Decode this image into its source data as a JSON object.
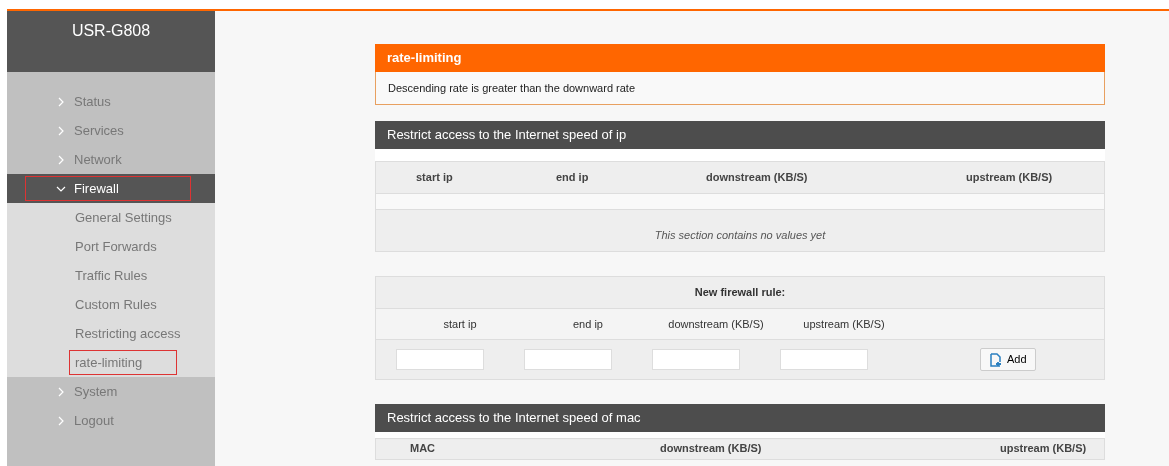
{
  "sidebar": {
    "title": "USR-G808",
    "items": [
      {
        "label": "Status",
        "expanded": false
      },
      {
        "label": "Services",
        "expanded": false
      },
      {
        "label": "Network",
        "expanded": false
      },
      {
        "label": "Firewall",
        "expanded": true,
        "children": [
          {
            "label": "General Settings",
            "selected": false
          },
          {
            "label": "Port Forwards",
            "selected": false
          },
          {
            "label": "Traffic Rules",
            "selected": false
          },
          {
            "label": "Custom Rules",
            "selected": false
          },
          {
            "label": "Restricting access",
            "selected": false
          },
          {
            "label": "rate-limiting",
            "selected": true
          }
        ]
      },
      {
        "label": "System",
        "expanded": false
      },
      {
        "label": "Logout",
        "expanded": false
      }
    ]
  },
  "alert": {
    "title": "rate-limiting",
    "message": "Descending rate is greater than the downward rate"
  },
  "ip_section": {
    "title": "Restrict access to the Internet speed of ip",
    "columns": [
      "start ip",
      "end ip",
      "downstream (KB/S)",
      "upstream (KB/S)"
    ],
    "empty_message": "This section contains no values yet",
    "new_rule": {
      "title": "New firewall rule:",
      "fields": [
        "start ip",
        "end ip",
        "downstream (KB/S)",
        "upstream (KB/S)"
      ],
      "button": "Add"
    }
  },
  "mac_section": {
    "title": "Restrict access to the Internet speed of mac",
    "columns": [
      "MAC",
      "downstream (KB/S)",
      "upstream (KB/S)"
    ]
  }
}
